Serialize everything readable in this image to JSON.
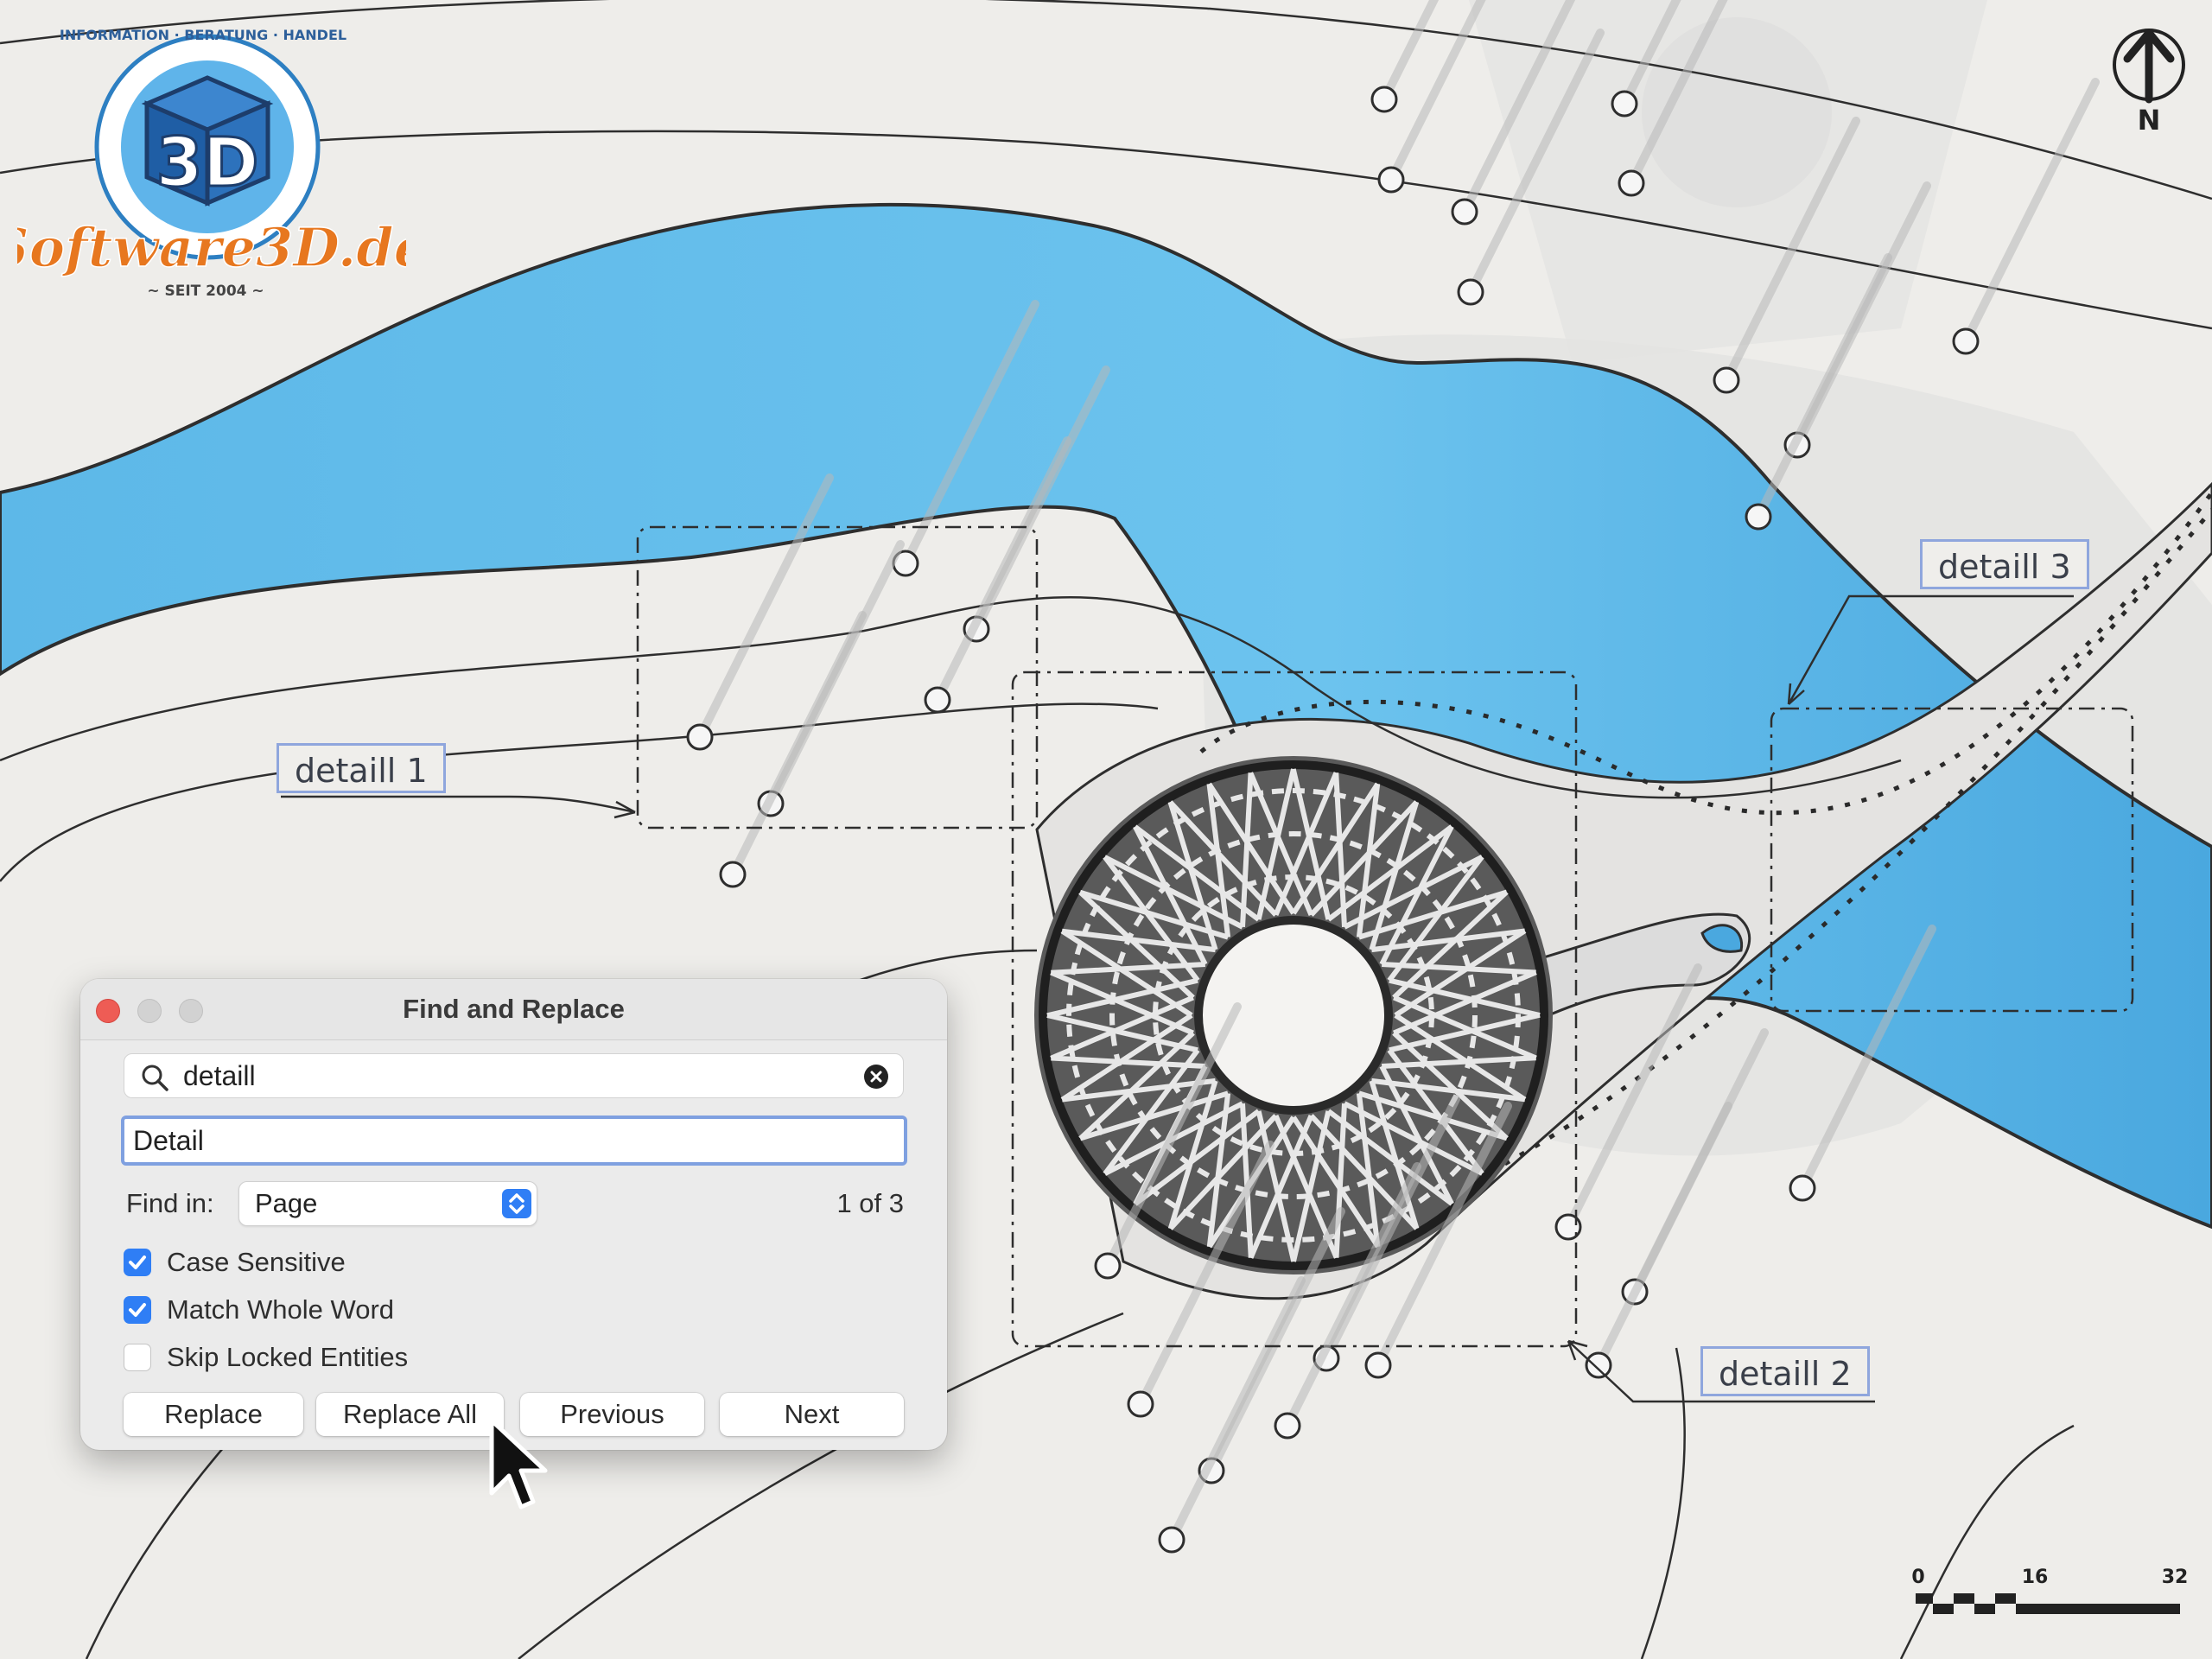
{
  "brand": {
    "logo_text": "Software3D.de",
    "logo_badge": "3D",
    "logo_ring_text": "INFORMATION · BERATUNG · HANDEL",
    "logo_since": "~ SEIT 2004 ~"
  },
  "map": {
    "north_label": "N",
    "scale": {
      "ticks": [
        "0",
        "16",
        "32"
      ]
    },
    "detail_labels": [
      "detaill 1",
      "detaill 2",
      "detaill 3"
    ],
    "colors": {
      "water": "#63bdea",
      "paper": "#eeedea",
      "line": "#2e2e2e",
      "label_border": "#8fa6dd"
    }
  },
  "dialog": {
    "title": "Find and Replace",
    "search_value": "detaill",
    "replace_value": "Detail",
    "find_in_label": "Find in:",
    "find_in_value": "Page",
    "match_count": "1 of 3",
    "options": [
      {
        "label": "Case Sensitive",
        "checked": true
      },
      {
        "label": "Match Whole Word",
        "checked": true
      },
      {
        "label": "Skip Locked Entities",
        "checked": false
      }
    ],
    "buttons": {
      "replace": "Replace",
      "replace_all": "Replace All",
      "previous": "Previous",
      "next": "Next"
    },
    "accent": "#2f7ef5"
  }
}
